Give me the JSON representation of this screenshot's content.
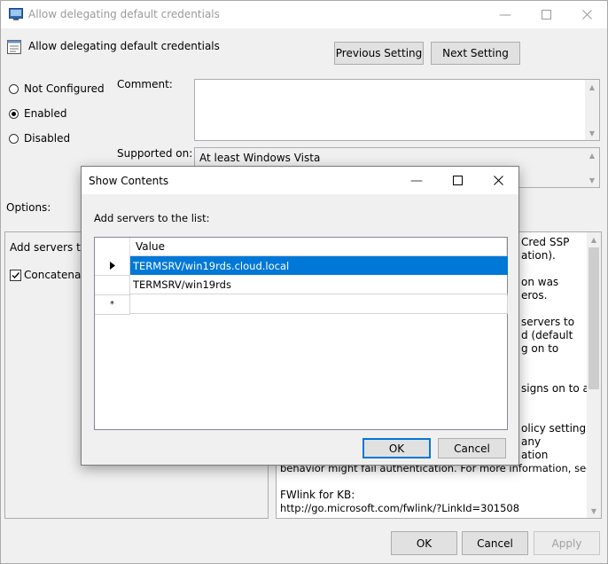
{
  "window": {
    "title": "Allow delegating default credentials",
    "setting_name": "Allow delegating default credentials",
    "previous_setting": "Previous Setting",
    "next_setting": "Next Setting"
  },
  "state": {
    "options": [
      "Not Configured",
      "Enabled",
      "Disabled"
    ],
    "selected": "Enabled"
  },
  "comment_label": "Comment:",
  "supported_on": {
    "label": "Supported on:",
    "value": "At least Windows Vista"
  },
  "options_label": "Options:",
  "options_panel": {
    "add_servers_label_partial": "Add servers to t",
    "concatenate_partial": "Concatenate",
    "concatenate_checked": true
  },
  "help_text_visible": [
    "Cred SSP",
    "ation).",
    "on was",
    "eros.",
    "servers to",
    "d (default",
    "g on to",
    "signs on to a",
    "olicy setting,",
    "any",
    "ation",
    "behavior might fail authentication. For more information, see KB.",
    "FWlink for KB:",
    "http://go.microsoft.com/fwlink/?LinkId=301508"
  ],
  "footer": {
    "ok": "OK",
    "cancel": "Cancel",
    "apply": "Apply"
  },
  "dialog": {
    "title": "Show Contents",
    "instruction": "Add servers to the list:",
    "column_header": "Value",
    "rows": [
      "TERMSRV/win19rds.cloud.local",
      "TERMSRV/win19rds"
    ],
    "selected_row": 0,
    "ok": "OK",
    "cancel": "Cancel"
  }
}
